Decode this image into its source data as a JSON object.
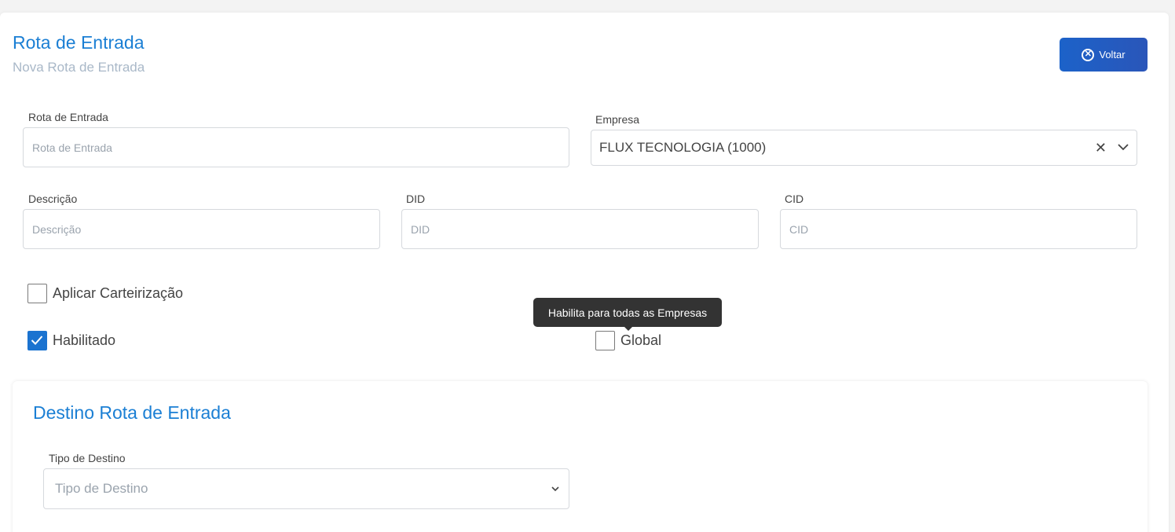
{
  "header": {
    "title": "Rota de Entrada",
    "subtitle": "Nova Rota de Entrada",
    "back_label": "Voltar"
  },
  "form": {
    "rota": {
      "label": "Rota de Entrada",
      "placeholder": "Rota de Entrada",
      "value": ""
    },
    "empresa": {
      "label": "Empresa",
      "value": "FLUX TECNOLOGIA (1000)"
    },
    "descricao": {
      "label": "Descrição",
      "placeholder": "Descrição",
      "value": ""
    },
    "did": {
      "label": "DID",
      "placeholder": "DID",
      "value": ""
    },
    "cid": {
      "label": "CID",
      "placeholder": "CID",
      "value": ""
    },
    "carteirizacao": {
      "label": "Aplicar Carteirização",
      "checked": false
    },
    "habilitado": {
      "label": "Habilitado",
      "checked": true
    },
    "global": {
      "label": "Global",
      "checked": false,
      "tooltip": "Habilita para todas as Empresas"
    }
  },
  "destino": {
    "title": "Destino Rota de Entrada",
    "tipo": {
      "label": "Tipo de Destino",
      "placeholder": "Tipo de Destino"
    }
  },
  "colors": {
    "accent": "#1b7fd4",
    "button": "#1c62c9",
    "checkbox_checked": "#1b73d0"
  }
}
